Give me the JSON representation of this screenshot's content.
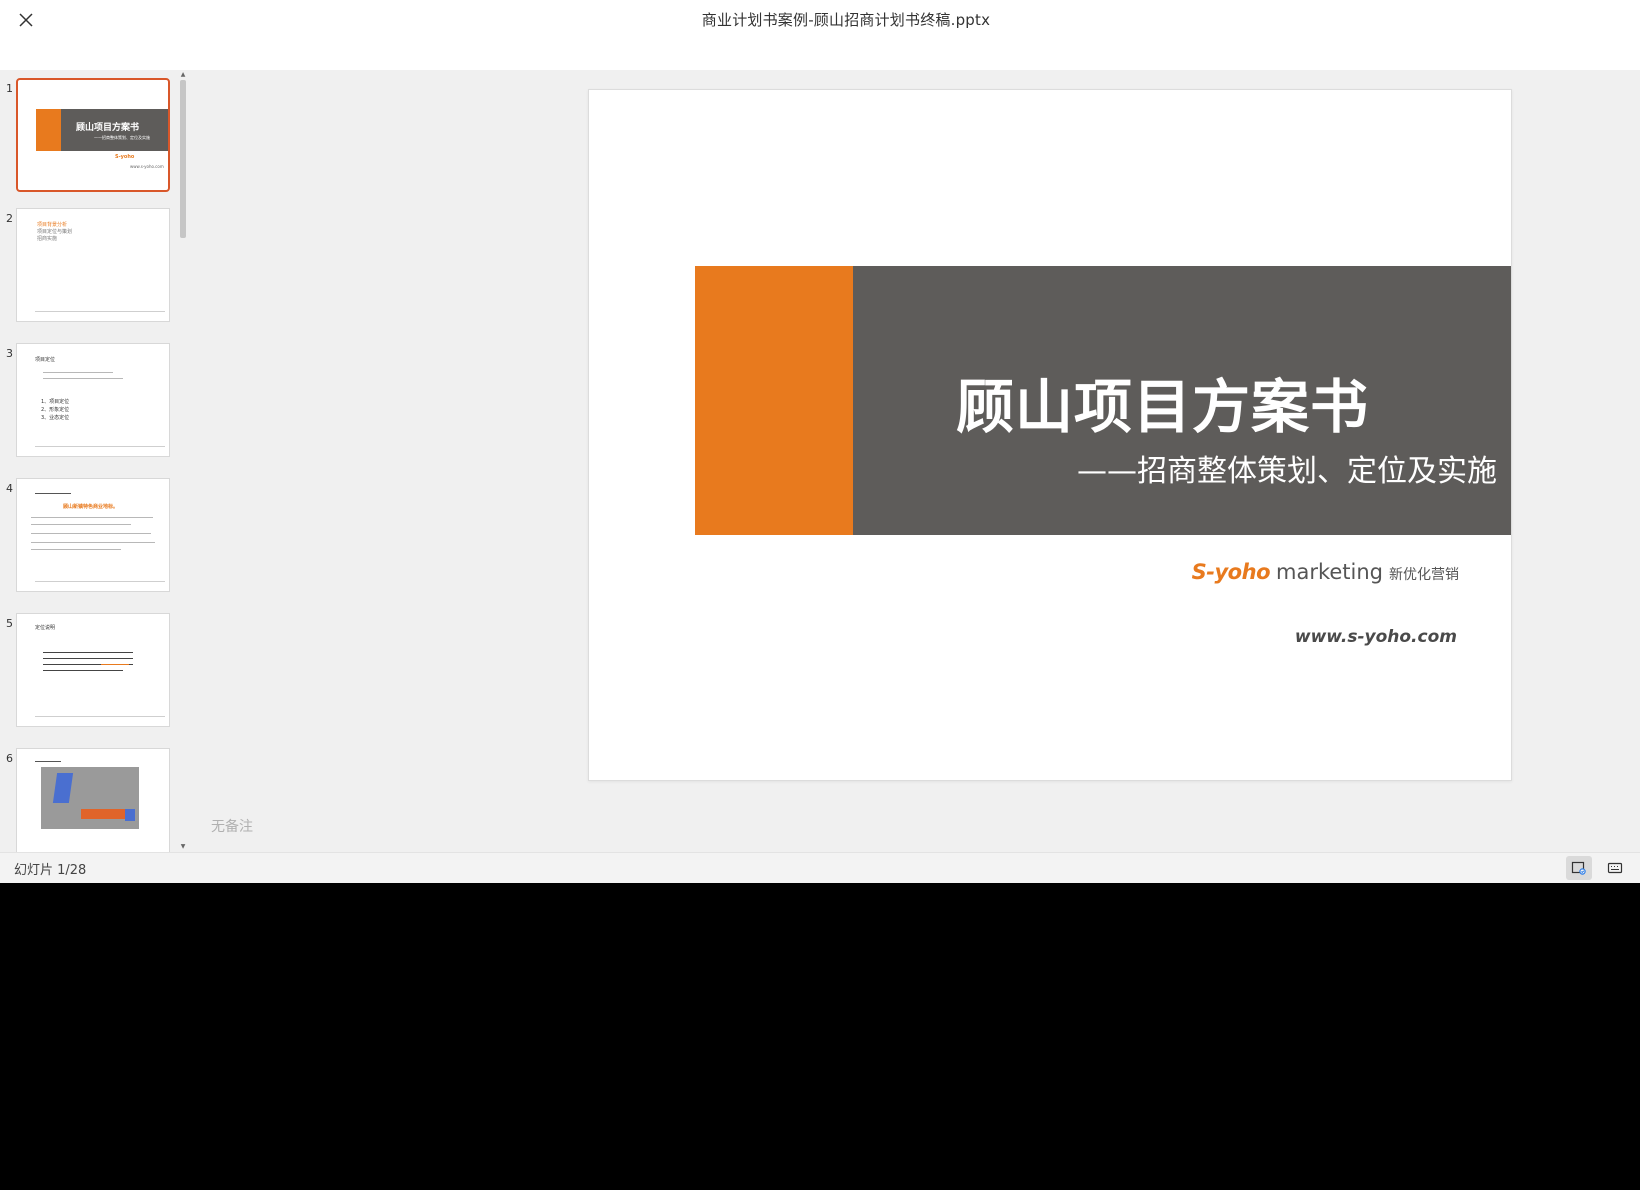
{
  "header": {
    "title": "商业计划书案例-顾山招商计划书终稿.pptx",
    "close_icon": "close-icon"
  },
  "thumbnails": [
    {
      "number": "1",
      "active": true
    },
    {
      "number": "2",
      "active": false
    },
    {
      "number": "3",
      "active": false
    },
    {
      "number": "4",
      "active": false
    },
    {
      "number": "5",
      "active": false
    },
    {
      "number": "6",
      "active": false
    }
  ],
  "thumb_text": {
    "t1_title": "顾山项目方案书",
    "t1_sub": "——招商整体策划、定位及实施",
    "t1_logo": "S-yoho",
    "t1_url": "www.s-yoho.com",
    "t2_item1": "项目背景分析",
    "t2_item2": "项目定位与策划",
    "t2_item3": "招商实施",
    "t3_head": "项目定位",
    "t3_line1": "1、项目定位",
    "t3_line2": "2、形象定位",
    "t3_line3": "3、业态定位",
    "t4_head": "顾山新镇特色商业地标。",
    "t5_head": "定位说明"
  },
  "slide": {
    "title": "顾山项目方案书",
    "subtitle": "——招商整体策划、定位及实施",
    "logo_mark": "S-yoho",
    "logo_word": "marketing",
    "logo_cn": "新优化营销",
    "url": "www.s-yoho.com"
  },
  "notes": {
    "placeholder": "无备注"
  },
  "status": {
    "slide_counter": "幻灯片 1/28"
  },
  "colors": {
    "accent_orange": "#e87a1e",
    "band_gray": "#5e5c5a",
    "active_thumb_border": "#d9572a"
  }
}
